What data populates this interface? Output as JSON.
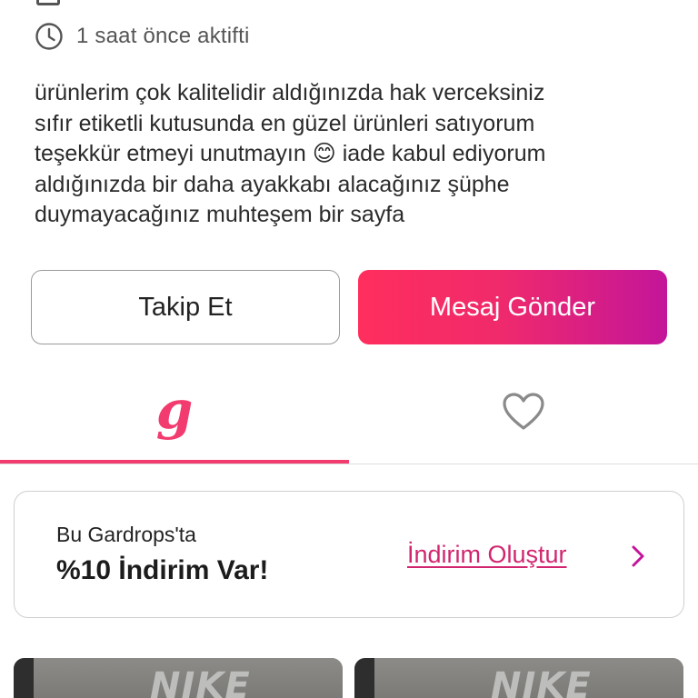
{
  "profile": {
    "last_active": "1 saat önce aktifti",
    "bio": "ürünlerim çok kalitelidir aldığınızda hak verceksiniz\nsıfır etiketli kutusunda en güzel ürünleri satıyorum\nteşekkür etmeyi unutmayın 😊 iade kabul ediyorum\naldığınızda bir daha ayakkabı alacağınız şüphe\nduymayacağınız muhteşem bir sayfa"
  },
  "actions": {
    "follow_label": "Takip Et",
    "message_label": "Mesaj Gönder"
  },
  "tabs": [
    {
      "id": "closet",
      "icon": "gardrops-g-icon",
      "active": true
    },
    {
      "id": "likes",
      "icon": "heart-icon",
      "active": false
    }
  ],
  "discount": {
    "subtitle": "Bu Gardrops'ta",
    "title": "%10 İndirim Var!",
    "link_label": "İndirim Oluştur"
  },
  "products": [
    {
      "brand_text": "NIKE"
    },
    {
      "brand_text": "NIKE"
    }
  ],
  "colors": {
    "accent": "#f23b6f",
    "gradient_start": "#ff2e5d",
    "gradient_end": "#c4159a",
    "link": "#d1266f"
  }
}
